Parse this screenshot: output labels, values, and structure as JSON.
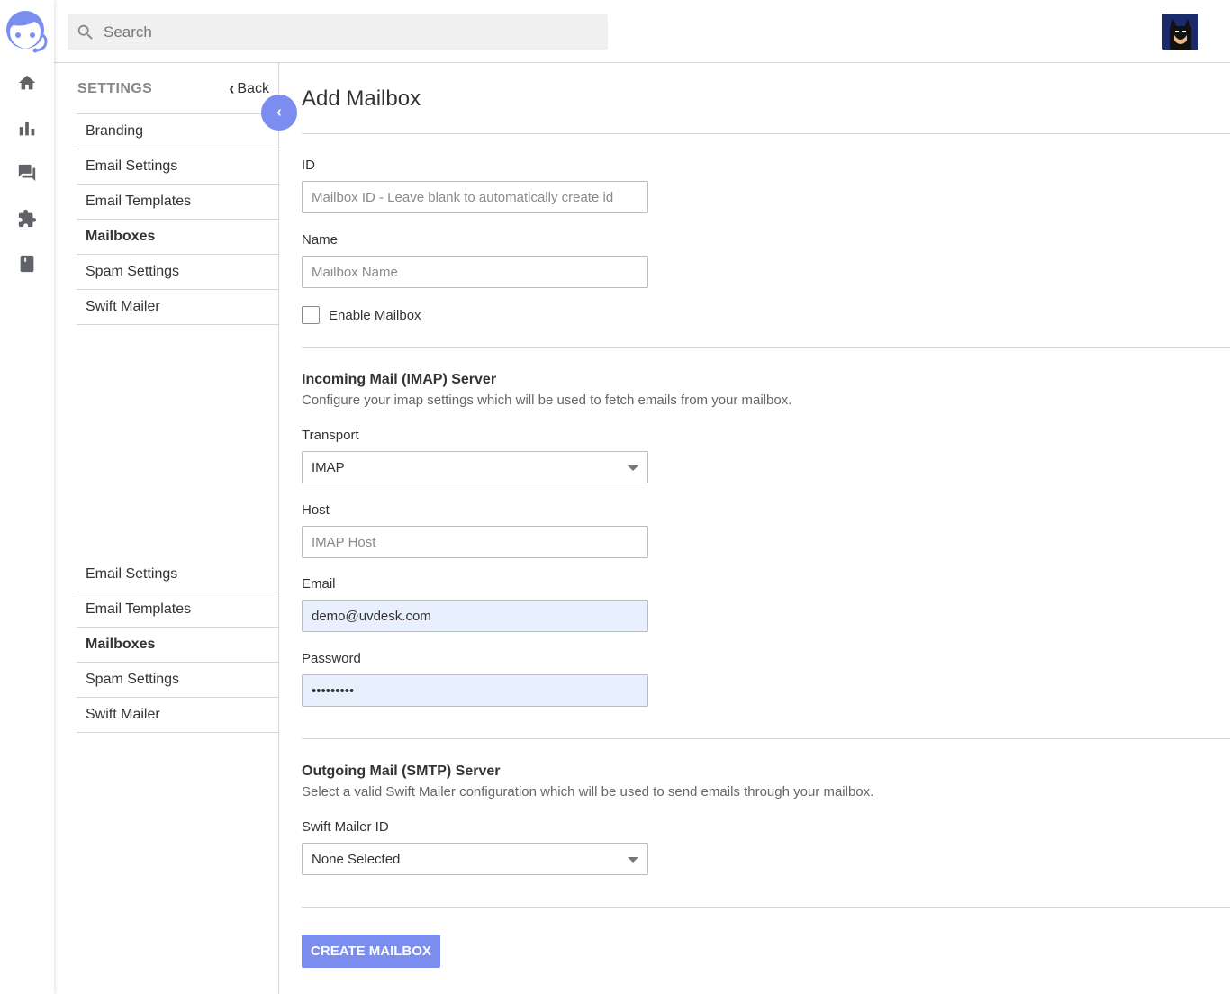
{
  "colors": {
    "accent": "#7b8ef0",
    "autofill": "#e8f0fe",
    "border": "#d6d6d6"
  },
  "topbar": {
    "search_placeholder": "Search"
  },
  "rail": {
    "icons": [
      "logo-icon",
      "home-icon",
      "bar-chart-icon",
      "forum-icon",
      "puzzle-icon",
      "bookmark-icon"
    ]
  },
  "settings": {
    "title": "SETTINGS",
    "back_label": "Back",
    "menu_primary": [
      {
        "label": "Branding",
        "active": false
      },
      {
        "label": "Email Settings",
        "active": false
      },
      {
        "label": "Email Templates",
        "active": false
      },
      {
        "label": "Mailboxes",
        "active": true
      },
      {
        "label": "Spam Settings",
        "active": false
      },
      {
        "label": "Swift Mailer",
        "active": false
      }
    ],
    "menu_secondary": [
      {
        "label": "Email Settings",
        "active": false
      },
      {
        "label": "Email Templates",
        "active": false
      },
      {
        "label": "Mailboxes",
        "active": true
      },
      {
        "label": "Spam Settings",
        "active": false
      },
      {
        "label": "Swift Mailer",
        "active": false
      }
    ]
  },
  "form": {
    "title": "Add Mailbox",
    "id_label": "ID",
    "id_placeholder": "Mailbox ID - Leave blank to automatically create id",
    "name_label": "Name",
    "name_placeholder": "Mailbox Name",
    "enable_label": "Enable Mailbox",
    "imap": {
      "title": "Incoming Mail (IMAP) Server",
      "description": "Configure your imap settings which will be used to fetch emails from your mailbox.",
      "transport_label": "Transport",
      "transport_value": "IMAP",
      "host_label": "Host",
      "host_placeholder": "IMAP Host",
      "email_label": "Email",
      "email_value": "demo@uvdesk.com",
      "password_label": "Password",
      "password_value": "•••••••••"
    },
    "smtp": {
      "title": "Outgoing Mail (SMTP) Server",
      "description": "Select a valid Swift Mailer configuration which will be used to send emails through your mailbox.",
      "mailer_label": "Swift Mailer ID",
      "mailer_value": "None Selected"
    },
    "submit_label": "CREATE MAILBOX"
  }
}
